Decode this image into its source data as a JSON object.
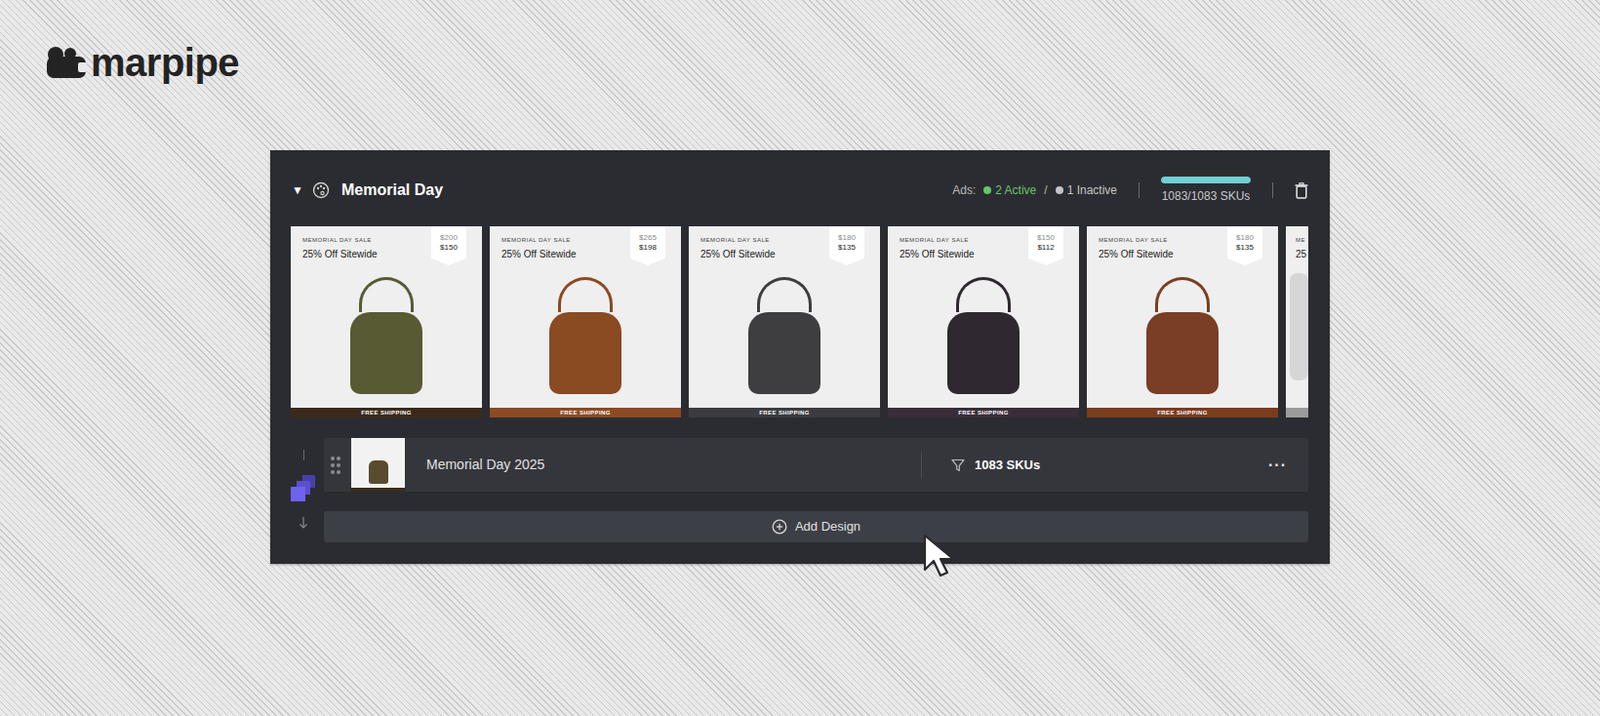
{
  "brand": {
    "name": "marpipe"
  },
  "campaign": {
    "toggle": "▼",
    "expanded": true,
    "title": "Memorial Day",
    "ads_label": "Ads:",
    "separator": "/",
    "ads_status": [
      {
        "text": "2 Active",
        "color": "#66c46f"
      },
      {
        "text": "1 Inactive",
        "color": "#c4c4c4"
      }
    ],
    "skus": {
      "text": "1083/1083 SKUs",
      "level": 1
    }
  },
  "ads": [
    {
      "kind": "full",
      "label": "MEMORIAL DAY SALE",
      "headline": "25% Off Sitewide",
      "price_old": "$200",
      "price_new": "$150",
      "footer": "FREE SHIPPING",
      "color": "#3b2a1b",
      "product_color": "#585a34"
    },
    {
      "kind": "full",
      "label": "MEMORIAL DAY SALE",
      "headline": "25% Off Sitewide",
      "price_old": "$265",
      "price_new": "$198",
      "footer": "FREE SHIPPING",
      "color": "#8b4a24",
      "product_color": "#8a4a22"
    },
    {
      "kind": "full",
      "label": "MEMORIAL DAY SALE",
      "headline": "25% Off Sitewide",
      "price_old": "$180",
      "price_new": "$135",
      "footer": "FREE SHIPPING",
      "color": "#3b3b40",
      "product_color": "#3e3e40"
    },
    {
      "kind": "full",
      "label": "MEMORIAL DAY SALE",
      "headline": "25% Off Sitewide",
      "price_old": "$150",
      "price_new": "$112",
      "footer": "FREE SHIPPING",
      "color": "#3a2d3a",
      "product_color": "#2f2830"
    },
    {
      "kind": "full",
      "label": "MEMORIAL DAY SALE",
      "headline": "25% Off Sitewide",
      "price_old": "$180",
      "price_new": "$135",
      "footer": "FREE SHIPPING",
      "color": "#7a3c1e",
      "product_color": "#7a3e24"
    },
    {
      "kind": "clipped",
      "label": "ME",
      "headline": "25",
      "color": "#9b9b9b",
      "product_color": "#d6d6d6"
    }
  ],
  "designs": [
    {
      "name": "Memorial Day 2025",
      "skus": "1083 SKUs",
      "more": "···"
    }
  ],
  "add_design": {
    "label": "Add Design"
  }
}
